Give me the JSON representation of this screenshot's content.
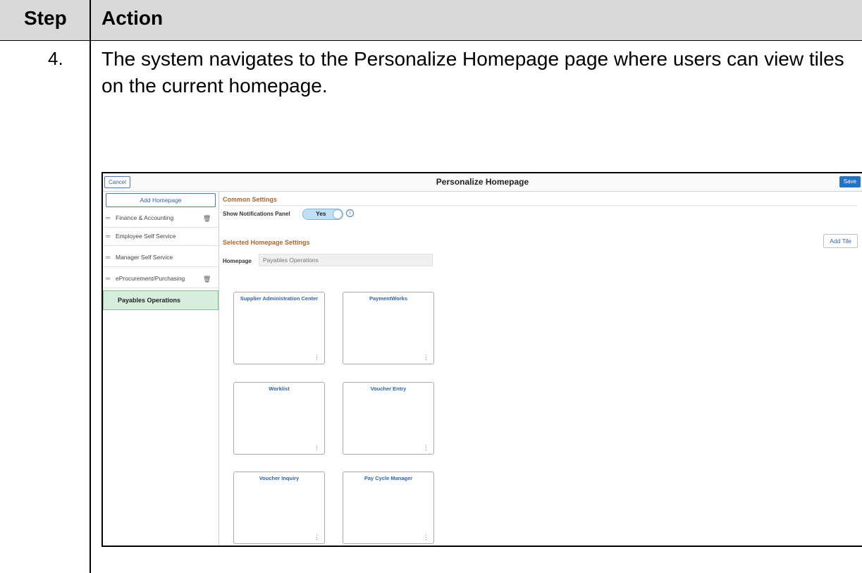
{
  "table": {
    "header_step": "Step",
    "header_action": "Action",
    "step_number": "4.",
    "description": "The system navigates to the Personalize Homepage page where users can view tiles on the current homepage."
  },
  "screenshot": {
    "cancel_label": "Cancel",
    "title": "Personalize Homepage",
    "save_label": "Save",
    "sidebar": {
      "add_homepage_label": "Add Homepage",
      "items": [
        {
          "label": "Finance & Accounting",
          "deletable": true
        },
        {
          "label": "Employee Self Service",
          "deletable": false
        },
        {
          "label": "Manager Self Service",
          "deletable": false
        },
        {
          "label": "eProcurement/Purchasing",
          "deletable": true
        }
      ],
      "active_item": "Payables Operations"
    },
    "common_settings": {
      "heading": "Common Settings",
      "notifications_label": "Show Notifications Panel",
      "notifications_value": "Yes"
    },
    "selected_settings": {
      "heading": "Selected Homepage Settings",
      "add_tile_label": "Add Tile",
      "homepage_label": "Homepage",
      "homepage_value": "Payables Operations"
    },
    "tiles": [
      {
        "title": "Supplier Administration Center"
      },
      {
        "title": "PaymentWorks"
      },
      {
        "title": "Worklist"
      },
      {
        "title": "Voucher Entry"
      },
      {
        "title": "Voucher Inquiry"
      },
      {
        "title": "Pay Cycle Manager"
      }
    ],
    "icons": {
      "drag": "drag-handle-icon",
      "trash": "trash-icon",
      "info": "info-icon",
      "tile_menu": "vertical-ellipsis-icon"
    },
    "colors": {
      "section_heading": "#b1652b",
      "link_blue": "#2c63b0",
      "save_button": "#1f73c9",
      "active_item_bg": "#d6efdc",
      "header_bg": "#d9d9d9"
    }
  }
}
